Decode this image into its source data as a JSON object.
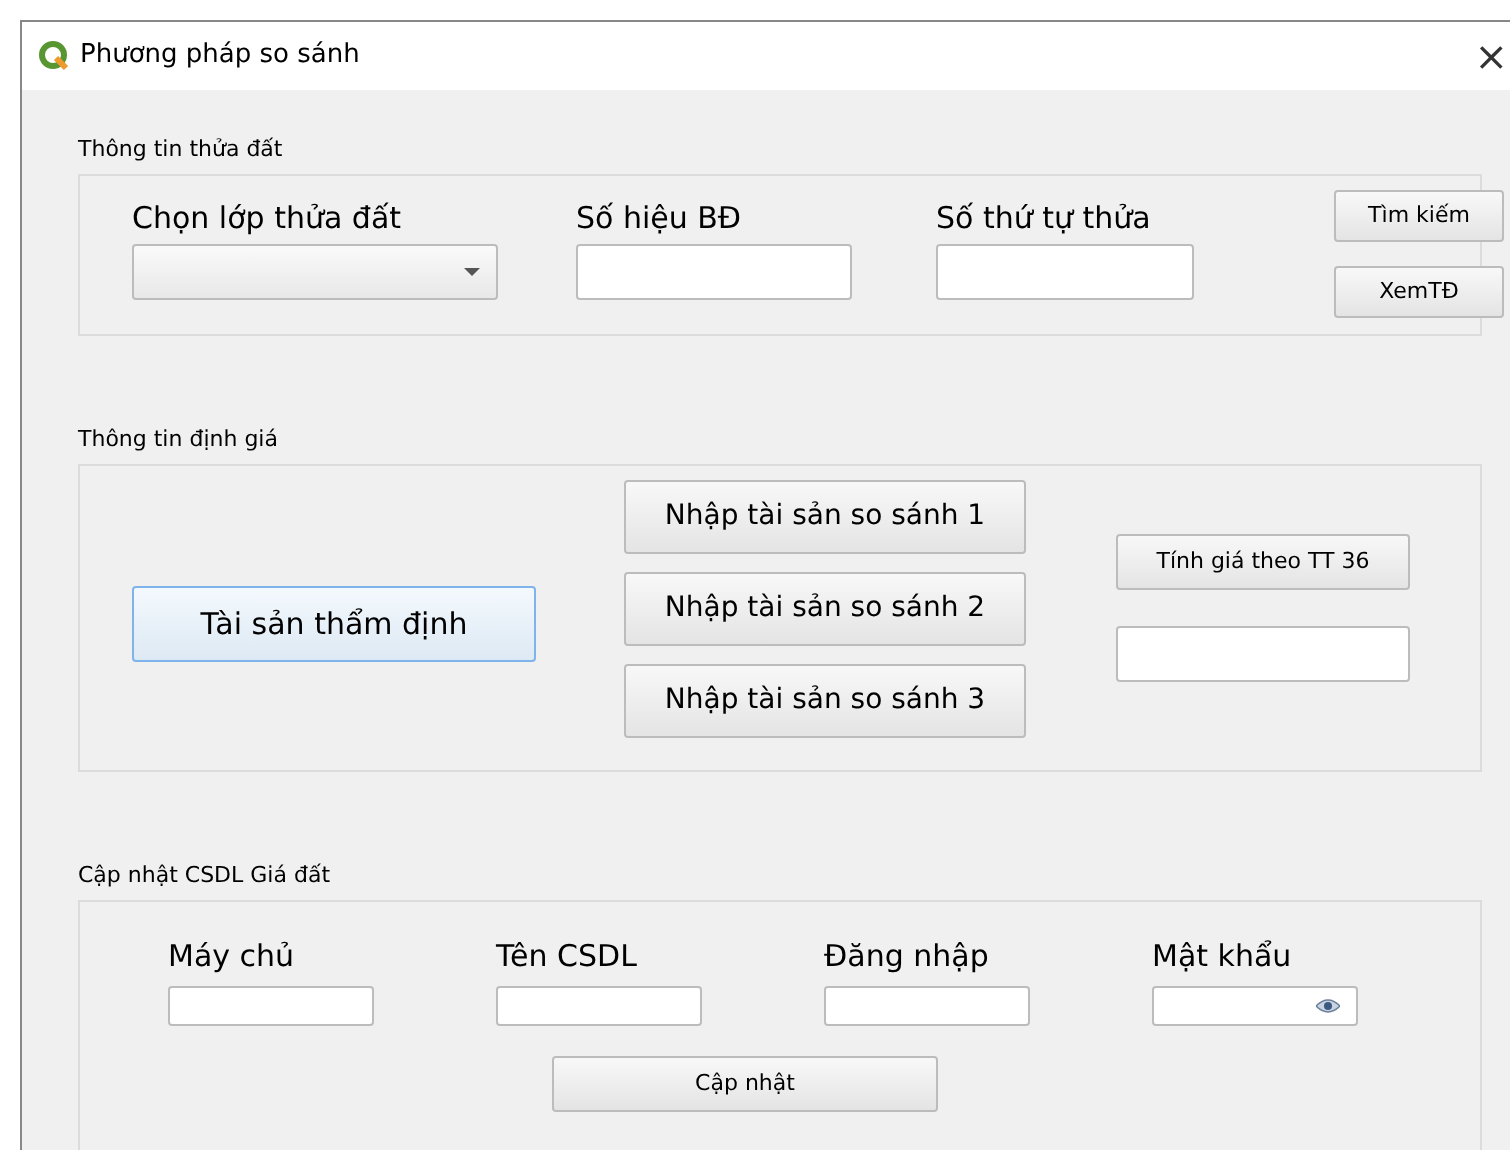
{
  "window": {
    "title": "Phương pháp so sánh",
    "close": "×"
  },
  "parcel_info": {
    "title": "Thông tin thửa đất",
    "fields": [
      {
        "label": "Chọn lớp thửa đất",
        "kind": "combo"
      },
      {
        "label": "Số hiệu BĐ",
        "kind": "text"
      },
      {
        "label": "Số thứ tự thửa",
        "kind": "text"
      }
    ],
    "buttons": [
      "Tìm kiếm",
      "XemTĐ"
    ]
  },
  "valuation_info": {
    "title": "Thông tin định giá",
    "main_button": {
      "label": "Tài sản thẩm định",
      "focused": true
    },
    "compare_buttons": [
      "Nhập tài sản so sánh 1",
      "Nhập tài sản so sánh 2",
      "Nhập tài sản so sánh 3"
    ],
    "calc_button": "Tính giá theo TT 36"
  },
  "db_update": {
    "title": "Cập nhật CSDL Giá đất",
    "fields": [
      {
        "label": "Máy chủ",
        "kind": "text"
      },
      {
        "label": "Tên CSDL",
        "kind": "text"
      },
      {
        "label": "Đăng nhập",
        "kind": "text"
      },
      {
        "label": "Mật khẩu",
        "kind": "password"
      }
    ],
    "button": "Cập nhật"
  }
}
